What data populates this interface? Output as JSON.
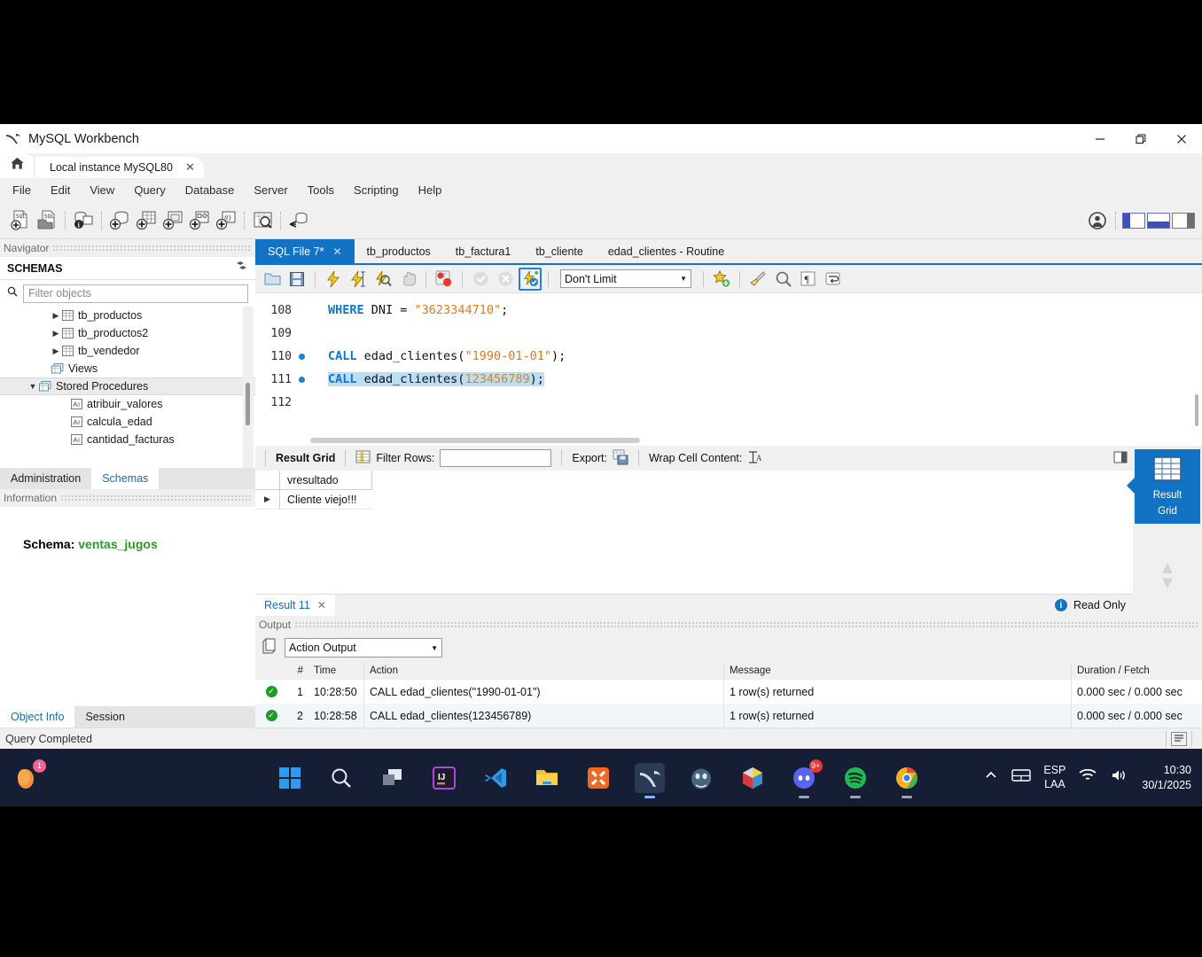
{
  "window": {
    "title": "MySQL Workbench",
    "logo_icon": "mysql-dolphin-icon",
    "minimize_label": "—",
    "restore_label": "❐",
    "close_label": "✕"
  },
  "instance_tabs": {
    "home_icon": "home-icon",
    "items": [
      {
        "label": "Local instance MySQL80",
        "close": "✕"
      }
    ]
  },
  "menubar": {
    "items": [
      "File",
      "Edit",
      "View",
      "Query",
      "Database",
      "Server",
      "Tools",
      "Scripting",
      "Help"
    ]
  },
  "main_toolbar": {
    "icons": [
      {
        "name": "new-sql-tab-icon"
      },
      {
        "name": "open-sql-script-icon"
      },
      {
        "name": "connection-info-icon"
      },
      {
        "name": "create-schema-icon"
      },
      {
        "name": "create-table-icon"
      },
      {
        "name": "create-view-icon"
      },
      {
        "name": "create-procedure-icon"
      },
      {
        "name": "create-function-icon"
      },
      {
        "name": "search-data-icon"
      },
      {
        "name": "reconnect-server-icon"
      }
    ],
    "right": [
      {
        "name": "user-account-icon"
      },
      {
        "name": "toggle-sidebar-icon"
      },
      {
        "name": "toggle-output-icon"
      },
      {
        "name": "toggle-secondary-sidebar-icon"
      }
    ]
  },
  "navigator": {
    "pane_title": "Navigator",
    "section_title": "SCHEMAS",
    "refresh_icon": "refresh-icon",
    "search_icon": "search-icon",
    "filter_placeholder": "Filter objects",
    "tree": [
      {
        "label": "tb_productos",
        "twisty": "▶",
        "icon": "table-icon",
        "indent": 56,
        "selected": false
      },
      {
        "label": "tb_productos2",
        "twisty": "▶",
        "icon": "table-icon",
        "indent": 56,
        "selected": false
      },
      {
        "label": "tb_vendedor",
        "twisty": "▶",
        "icon": "table-icon",
        "indent": 56,
        "selected": false
      },
      {
        "label": "Views",
        "twisty": "",
        "icon": "views-icon",
        "indent": 44,
        "selected": false
      },
      {
        "label": "Stored Procedures",
        "twisty": "▼",
        "icon": "procedures-icon",
        "indent": 30,
        "selected": true
      },
      {
        "label": "atribuir_valores",
        "twisty": "",
        "icon": "routine-icon",
        "indent": 66,
        "selected": false
      },
      {
        "label": "calcula_edad",
        "twisty": "",
        "icon": "routine-icon",
        "indent": 66,
        "selected": false
      },
      {
        "label": "cantidad_facturas",
        "twisty": "",
        "icon": "routine-icon",
        "indent": 66,
        "selected": false
      }
    ],
    "tabs": [
      {
        "label": "Administration",
        "active": false
      },
      {
        "label": "Schemas",
        "active": true
      }
    ]
  },
  "information": {
    "pane_title": "Information",
    "schema_label": "Schema:",
    "schema_value": "ventas_jugos",
    "tabs": [
      {
        "label": "Object Info",
        "active": true
      },
      {
        "label": "Session",
        "active": false
      }
    ]
  },
  "editor": {
    "tabs": [
      {
        "label": "SQL File 7*",
        "active": true,
        "close": "✕"
      },
      {
        "label": "tb_productos",
        "active": false,
        "close": ""
      },
      {
        "label": "tb_factura1",
        "active": false,
        "close": ""
      },
      {
        "label": "tb_cliente",
        "active": false,
        "close": ""
      },
      {
        "label": "edad_clientes - Routine",
        "active": false,
        "close": ""
      }
    ],
    "toolbar": {
      "icons": [
        {
          "name": "open-file-icon"
        },
        {
          "name": "save-file-icon"
        },
        {
          "name": "execute-statement-icon"
        },
        {
          "name": "execute-current-statement-icon"
        },
        {
          "name": "explain-statement-icon"
        },
        {
          "name": "stop-execution-icon"
        },
        {
          "name": "toggle-stop-on-error-icon"
        },
        {
          "name": "commit-transaction-icon"
        },
        {
          "name": "rollback-transaction-icon"
        },
        {
          "name": "toggle-autocommit-icon"
        },
        {
          "name": "beautify-query-icon"
        },
        {
          "name": "clear-query-icon"
        },
        {
          "name": "find-icon"
        },
        {
          "name": "toggle-invisible-chars-icon"
        },
        {
          "name": "toggle-word-wrap-icon"
        }
      ],
      "limit_value": "Don't Limit",
      "limit_arrow": "▼"
    },
    "lines": [
      {
        "number": "108",
        "breakpoint": false,
        "selected": false,
        "segments": [
          {
            "text": "WHERE",
            "cls": "kw"
          },
          {
            "text": " DNI = ",
            "cls": ""
          },
          {
            "text": "\"3623344710\"",
            "cls": "str"
          },
          {
            "text": ";",
            "cls": ""
          }
        ]
      },
      {
        "number": "109",
        "breakpoint": false,
        "selected": false,
        "segments": []
      },
      {
        "number": "110",
        "breakpoint": true,
        "selected": false,
        "segments": [
          {
            "text": "CALL",
            "cls": "kw"
          },
          {
            "text": " edad_clientes(",
            "cls": ""
          },
          {
            "text": "\"1990-01-01\"",
            "cls": "str"
          },
          {
            "text": ");",
            "cls": ""
          }
        ]
      },
      {
        "number": "111",
        "breakpoint": true,
        "selected": true,
        "segments": [
          {
            "text": "CALL",
            "cls": "kw"
          },
          {
            "text": " edad_clientes(",
            "cls": ""
          },
          {
            "text": "123456789",
            "cls": "num"
          },
          {
            "text": ");",
            "cls": ""
          }
        ]
      },
      {
        "number": "112",
        "breakpoint": false,
        "selected": false,
        "segments": []
      }
    ]
  },
  "result_toolbar": {
    "grid_label": "Result Grid",
    "grid_icon": "result-grid-icon",
    "filter_label": "Filter Rows:",
    "filter_value": "",
    "export_label": "Export:",
    "export_icon": "export-icon",
    "wrap_label": "Wrap Cell Content:",
    "wrap_icon": "wrap-cell-icon",
    "maximize_icon": "maximize-panel-icon"
  },
  "result_grid": {
    "columns": [
      "vresultado"
    ],
    "rows": [
      {
        "marker": "▶",
        "cells": [
          "Cliente viejo!!!"
        ]
      }
    ]
  },
  "result_sidebar": {
    "tab_label_line1": "Result",
    "tab_label_line2": "Grid",
    "tab_icon": "result-grid-icon",
    "scroll_up_icon": "chevron-up-icon",
    "scroll_down_icon": "chevron-down-icon"
  },
  "result_footer": {
    "tabs": [
      {
        "label": "Result 11",
        "close": "✕"
      }
    ],
    "readonly_label": "Read Only",
    "readonly_icon": "info-icon"
  },
  "output": {
    "pane_title": "Output",
    "snippet_icon": "copy-icon",
    "select_value": "Action Output",
    "select_arrow": "▼",
    "columns": [
      "#",
      "Time",
      "Action",
      "Message",
      "Duration / Fetch"
    ],
    "rows": [
      {
        "status": "success",
        "num": "1",
        "time": "10:28:50",
        "action": "CALL edad_clientes(\"1990-01-01\")",
        "message": "1 row(s) returned",
        "duration": "0.000 sec / 0.000 sec"
      },
      {
        "status": "success",
        "num": "2",
        "time": "10:28:58",
        "action": "CALL edad_clientes(123456789)",
        "message": "1 row(s) returned",
        "duration": "0.000 sec / 0.000 sec"
      }
    ]
  },
  "statusbar": {
    "message": "Query Completed",
    "right_icon": "log-panel-icon"
  },
  "taskbar": {
    "left_icon": {
      "name": "copilot-icon",
      "badge": "1"
    },
    "items": [
      {
        "name": "start-icon",
        "label": "",
        "running": false
      },
      {
        "name": "search-icon",
        "label": "",
        "running": false
      },
      {
        "name": "task-view-icon",
        "label": "",
        "running": false
      },
      {
        "name": "intellij-idea-icon",
        "label": "IJ",
        "running": false
      },
      {
        "name": "vs-code-icon",
        "label": "",
        "running": false
      },
      {
        "name": "file-explorer-icon",
        "label": "",
        "running": false
      },
      {
        "name": "xampp-icon",
        "label": "",
        "running": false
      },
      {
        "name": "mysql-workbench-icon",
        "label": "",
        "running": true,
        "active": true
      },
      {
        "name": "postgresql-icon",
        "label": "",
        "running": false
      },
      {
        "name": "unity-hub-icon",
        "label": "",
        "running": false
      },
      {
        "name": "discord-icon",
        "label": "",
        "running": true,
        "badge": "9+"
      },
      {
        "name": "spotify-icon",
        "label": "",
        "running": true
      },
      {
        "name": "google-chrome-icon",
        "label": "",
        "running": true
      }
    ],
    "tray": {
      "chevron_icon": "chevron-up-icon",
      "keyboard_icon": "keyboard-icon",
      "lang_line1": "ESP",
      "lang_line2": "LAA",
      "wifi_icon": "wifi-icon",
      "volume_icon": "volume-icon",
      "time": "10:30",
      "date": "30/1/2025"
    }
  },
  "colors": {
    "accent": "#1273c4",
    "window_bg": "#f0f0f0",
    "taskbar_bg": "#161e36",
    "keyword": "#1078c8",
    "string": "#e07a1e",
    "success": "#1f9b26"
  }
}
